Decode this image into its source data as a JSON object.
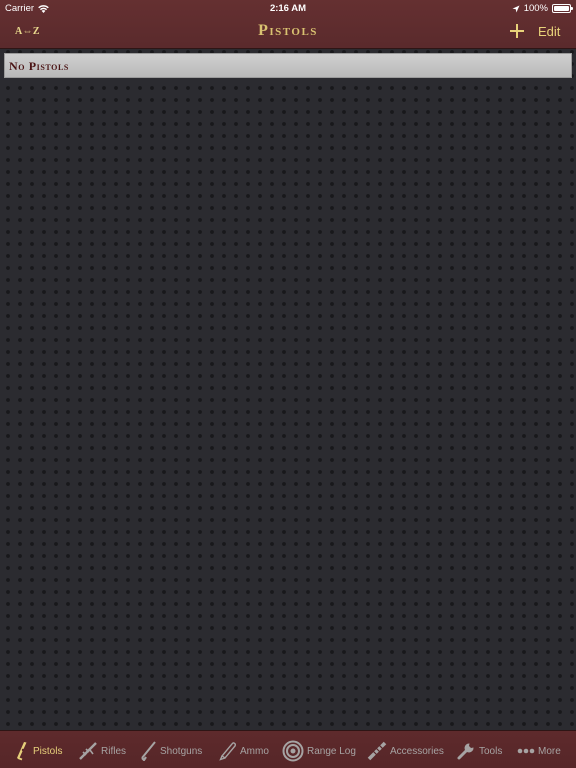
{
  "status_bar": {
    "carrier": "Carrier",
    "time": "2:16 AM",
    "battery": "100%",
    "battery_level": 1.0
  },
  "nav": {
    "sort_label": "A⇔Z",
    "title": "Pistols",
    "edit_label": "Edit"
  },
  "list": {
    "section_header": "No Pistols"
  },
  "tabs": [
    {
      "label": "Pistols",
      "icon": "pistol-icon",
      "active": true
    },
    {
      "label": "Rifles",
      "icon": "rifle-icon",
      "active": false
    },
    {
      "label": "Shotguns",
      "icon": "shotgun-icon",
      "active": false
    },
    {
      "label": "Ammo",
      "icon": "ammo-icon",
      "active": false
    },
    {
      "label": "Range Log",
      "icon": "target-icon",
      "active": false
    },
    {
      "label": "Accessories",
      "icon": "scope-icon",
      "active": false
    },
    {
      "label": "Tools",
      "icon": "wrench-icon",
      "active": false
    },
    {
      "label": "More",
      "icon": "more-dots-icon",
      "active": false
    }
  ],
  "colors": {
    "nav_background": "#5e2a2c",
    "accent_gold": "#e6d07b",
    "inactive_tab": "#a6a3a3",
    "section_text": "#4a1314",
    "page_background": "#2b2b30"
  }
}
